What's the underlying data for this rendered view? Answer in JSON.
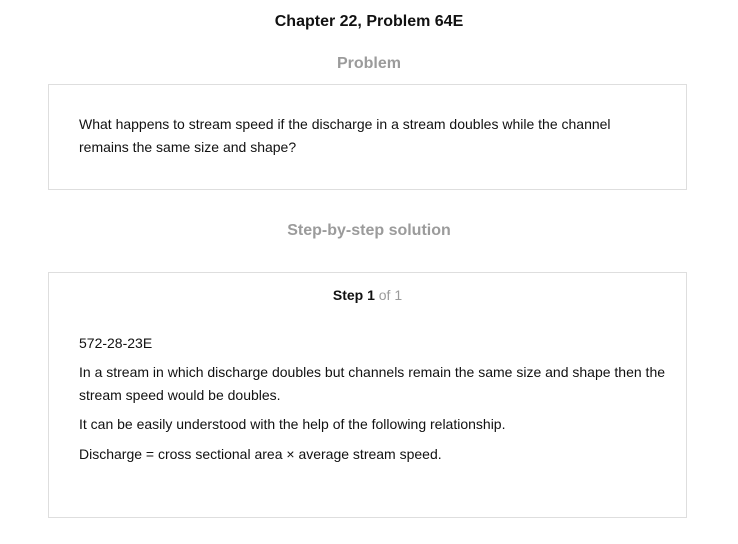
{
  "header": {
    "title": "Chapter 22, Problem 64E"
  },
  "problem": {
    "heading": "Problem",
    "text": "What happens to stream speed if the discharge in a stream doubles while the channel remains the same size and shape?"
  },
  "solution": {
    "heading": "Step-by-step solution",
    "step_label": "Step 1",
    "step_of": "of 1",
    "code": "572-28-23E",
    "paragraph_1": "In a stream in which discharge doubles but channels remain the same size and shape then the stream speed would be doubles.",
    "paragraph_2": "It can be easily understood with the help of the following relationship.",
    "paragraph_3": "Discharge = cross sectional area × average stream speed."
  }
}
